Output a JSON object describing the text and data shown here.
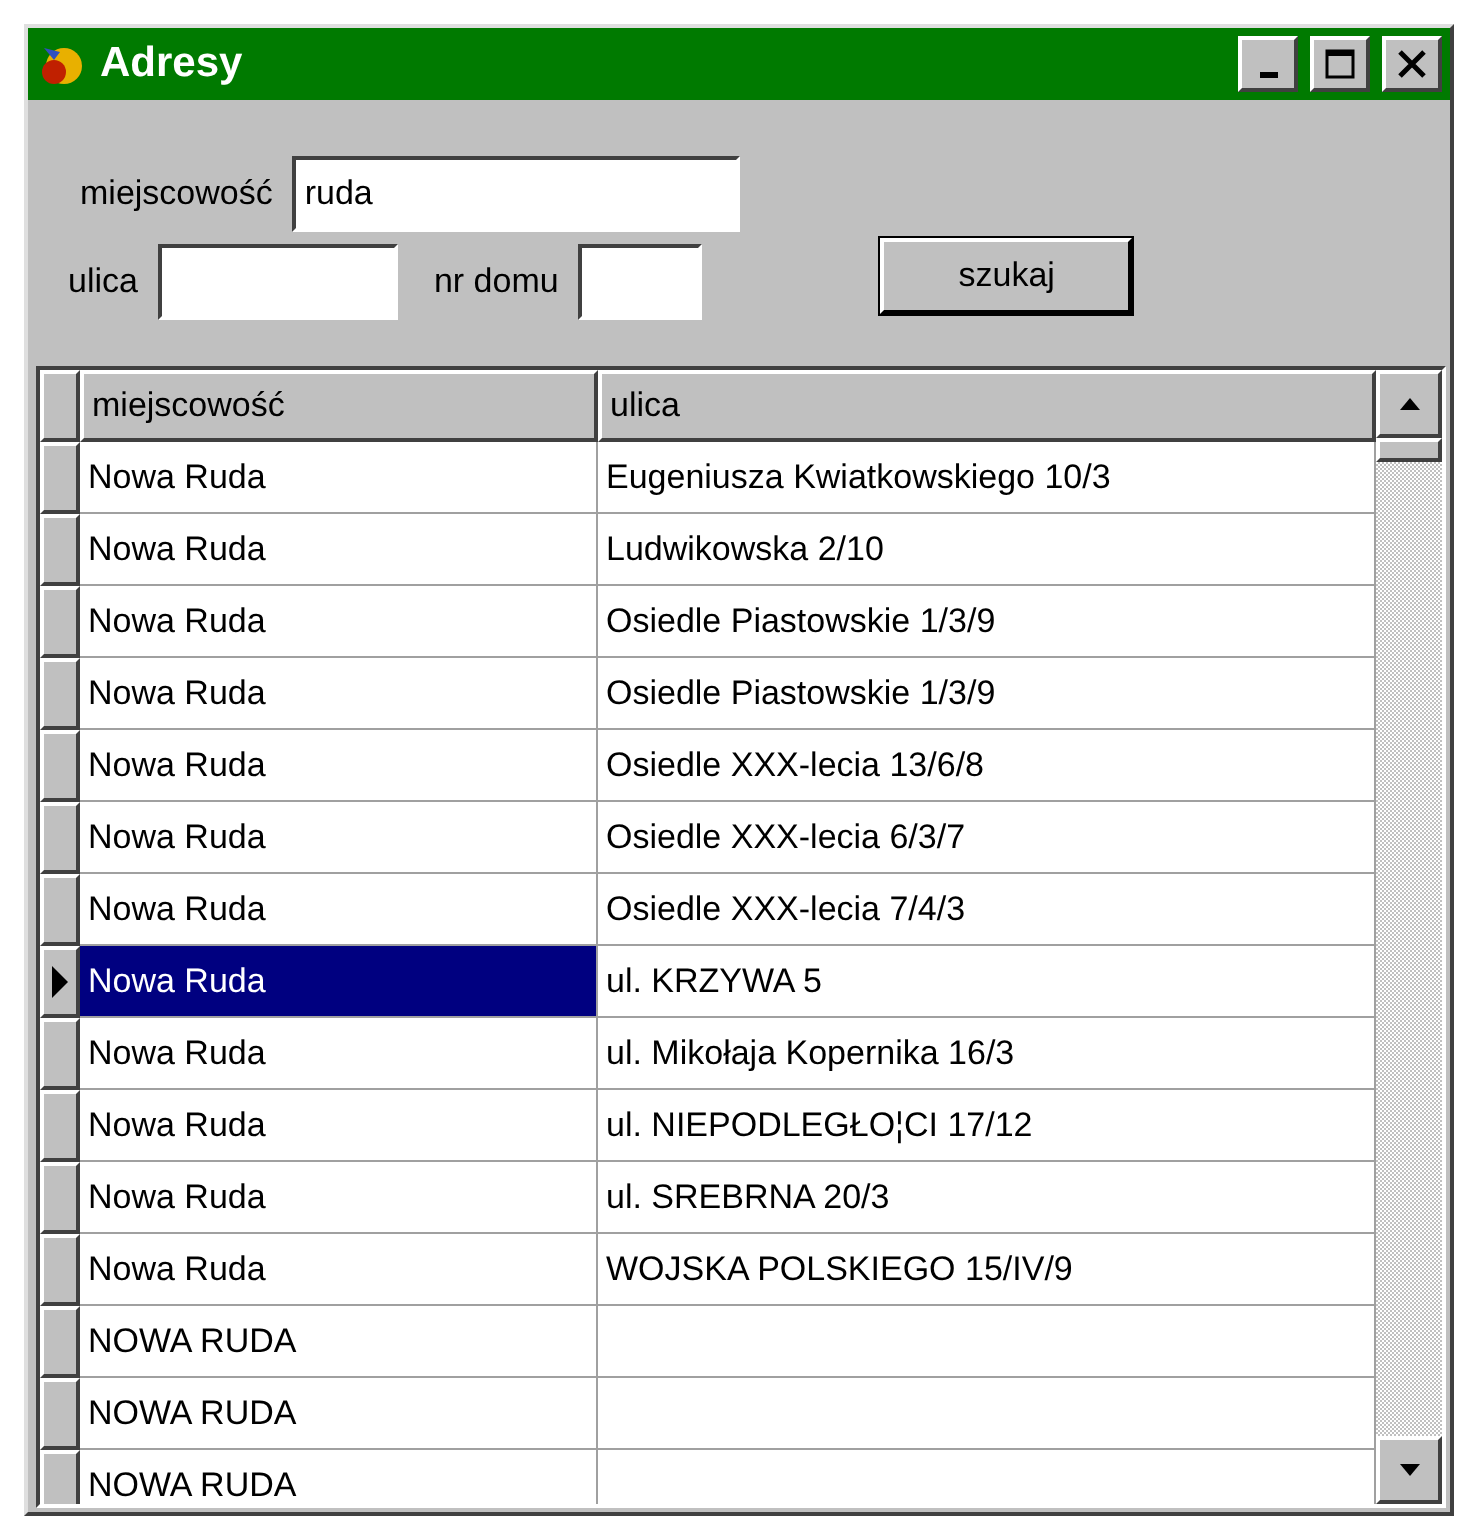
{
  "window": {
    "title": "Adresy"
  },
  "form": {
    "town_label": "miejscowość",
    "town_value": "ruda",
    "street_label": "ulica",
    "house_label": "nr domu",
    "search_button": "szukaj"
  },
  "table": {
    "columns": [
      "miejscowość",
      "ulica"
    ],
    "rows": [
      {
        "town": "Nowa Ruda",
        "street": "Eugeniusza Kwiatkowskiego 10/3",
        "selected": false
      },
      {
        "town": "Nowa Ruda",
        "street": "Ludwikowska 2/10",
        "selected": false
      },
      {
        "town": "Nowa Ruda",
        "street": "Osiedle Piastowskie 1/3/9",
        "selected": false
      },
      {
        "town": "Nowa Ruda",
        "street": "Osiedle Piastowskie 1/3/9",
        "selected": false
      },
      {
        "town": "Nowa Ruda",
        "street": "Osiedle XXX-lecia 13/6/8",
        "selected": false
      },
      {
        "town": "Nowa Ruda",
        "street": "Osiedle XXX-lecia 6/3/7",
        "selected": false
      },
      {
        "town": "Nowa Ruda",
        "street": "Osiedle XXX-lecia 7/4/3",
        "selected": false
      },
      {
        "town": "Nowa Ruda",
        "street": "ul. KRZYWA 5",
        "selected": true
      },
      {
        "town": "Nowa Ruda",
        "street": "ul. Mikołaja Kopernika 16/3",
        "selected": false
      },
      {
        "town": "Nowa Ruda",
        "street": "ul. NIEPODLEGŁO¦CI 17/12",
        "selected": false
      },
      {
        "town": "Nowa Ruda",
        "street": "ul. SREBRNA 20/3",
        "selected": false
      },
      {
        "town": "Nowa Ruda",
        "street": "WOJSKA POLSKIEGO 15/IV/9",
        "selected": false
      },
      {
        "town": "NOWA RUDA",
        "selected": false
      },
      {
        "town": "NOWA RUDA",
        "selected": false
      },
      {
        "town": "NOWA RUDA",
        "selected": false
      }
    ]
  }
}
